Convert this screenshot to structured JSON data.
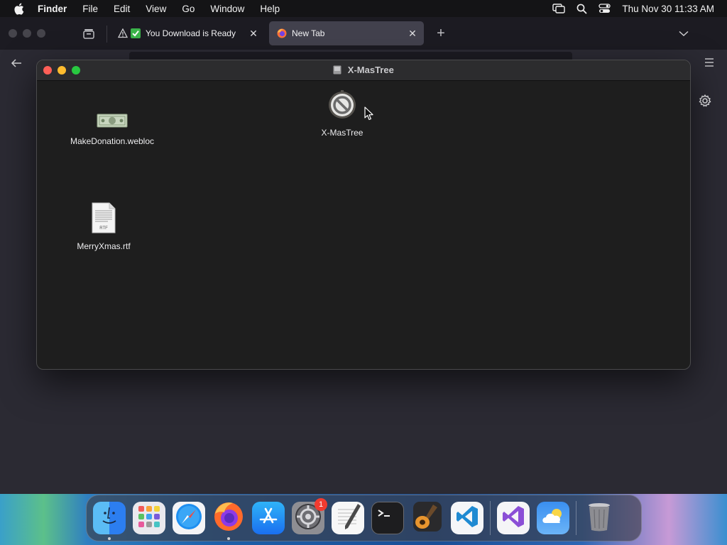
{
  "menubar": {
    "app_name": "Finder",
    "items": [
      "File",
      "Edit",
      "View",
      "Go",
      "Window",
      "Help"
    ],
    "clock": "Thu Nov 30  11:33 AM"
  },
  "browser": {
    "tabs": [
      {
        "title": "You Download is Ready",
        "active": false
      },
      {
        "title": "New Tab",
        "active": true
      }
    ]
  },
  "finder": {
    "title": "X-MasTree",
    "items": [
      {
        "label": "X-MasTree",
        "icon": "prohibited-app-icon"
      },
      {
        "label": "MakeDonation.webloc",
        "icon": "dollar-bill-icon"
      },
      {
        "label": "MerryXmas.rtf",
        "icon": "rtf-document-icon",
        "badge": "RTF"
      }
    ]
  },
  "dock": {
    "apps": [
      "Finder",
      "Launchpad",
      "Safari",
      "Firefox",
      "App Store",
      "System Settings",
      "TextEdit",
      "Terminal",
      "GarageBand",
      "Visual Studio Code",
      "Visual Studio",
      "Weather",
      "Trash"
    ],
    "settings_badge": "1"
  },
  "colors": {
    "close": "#fe5f57",
    "minimize": "#febc2e",
    "zoom": "#28c840",
    "badge": "#f23b30"
  }
}
